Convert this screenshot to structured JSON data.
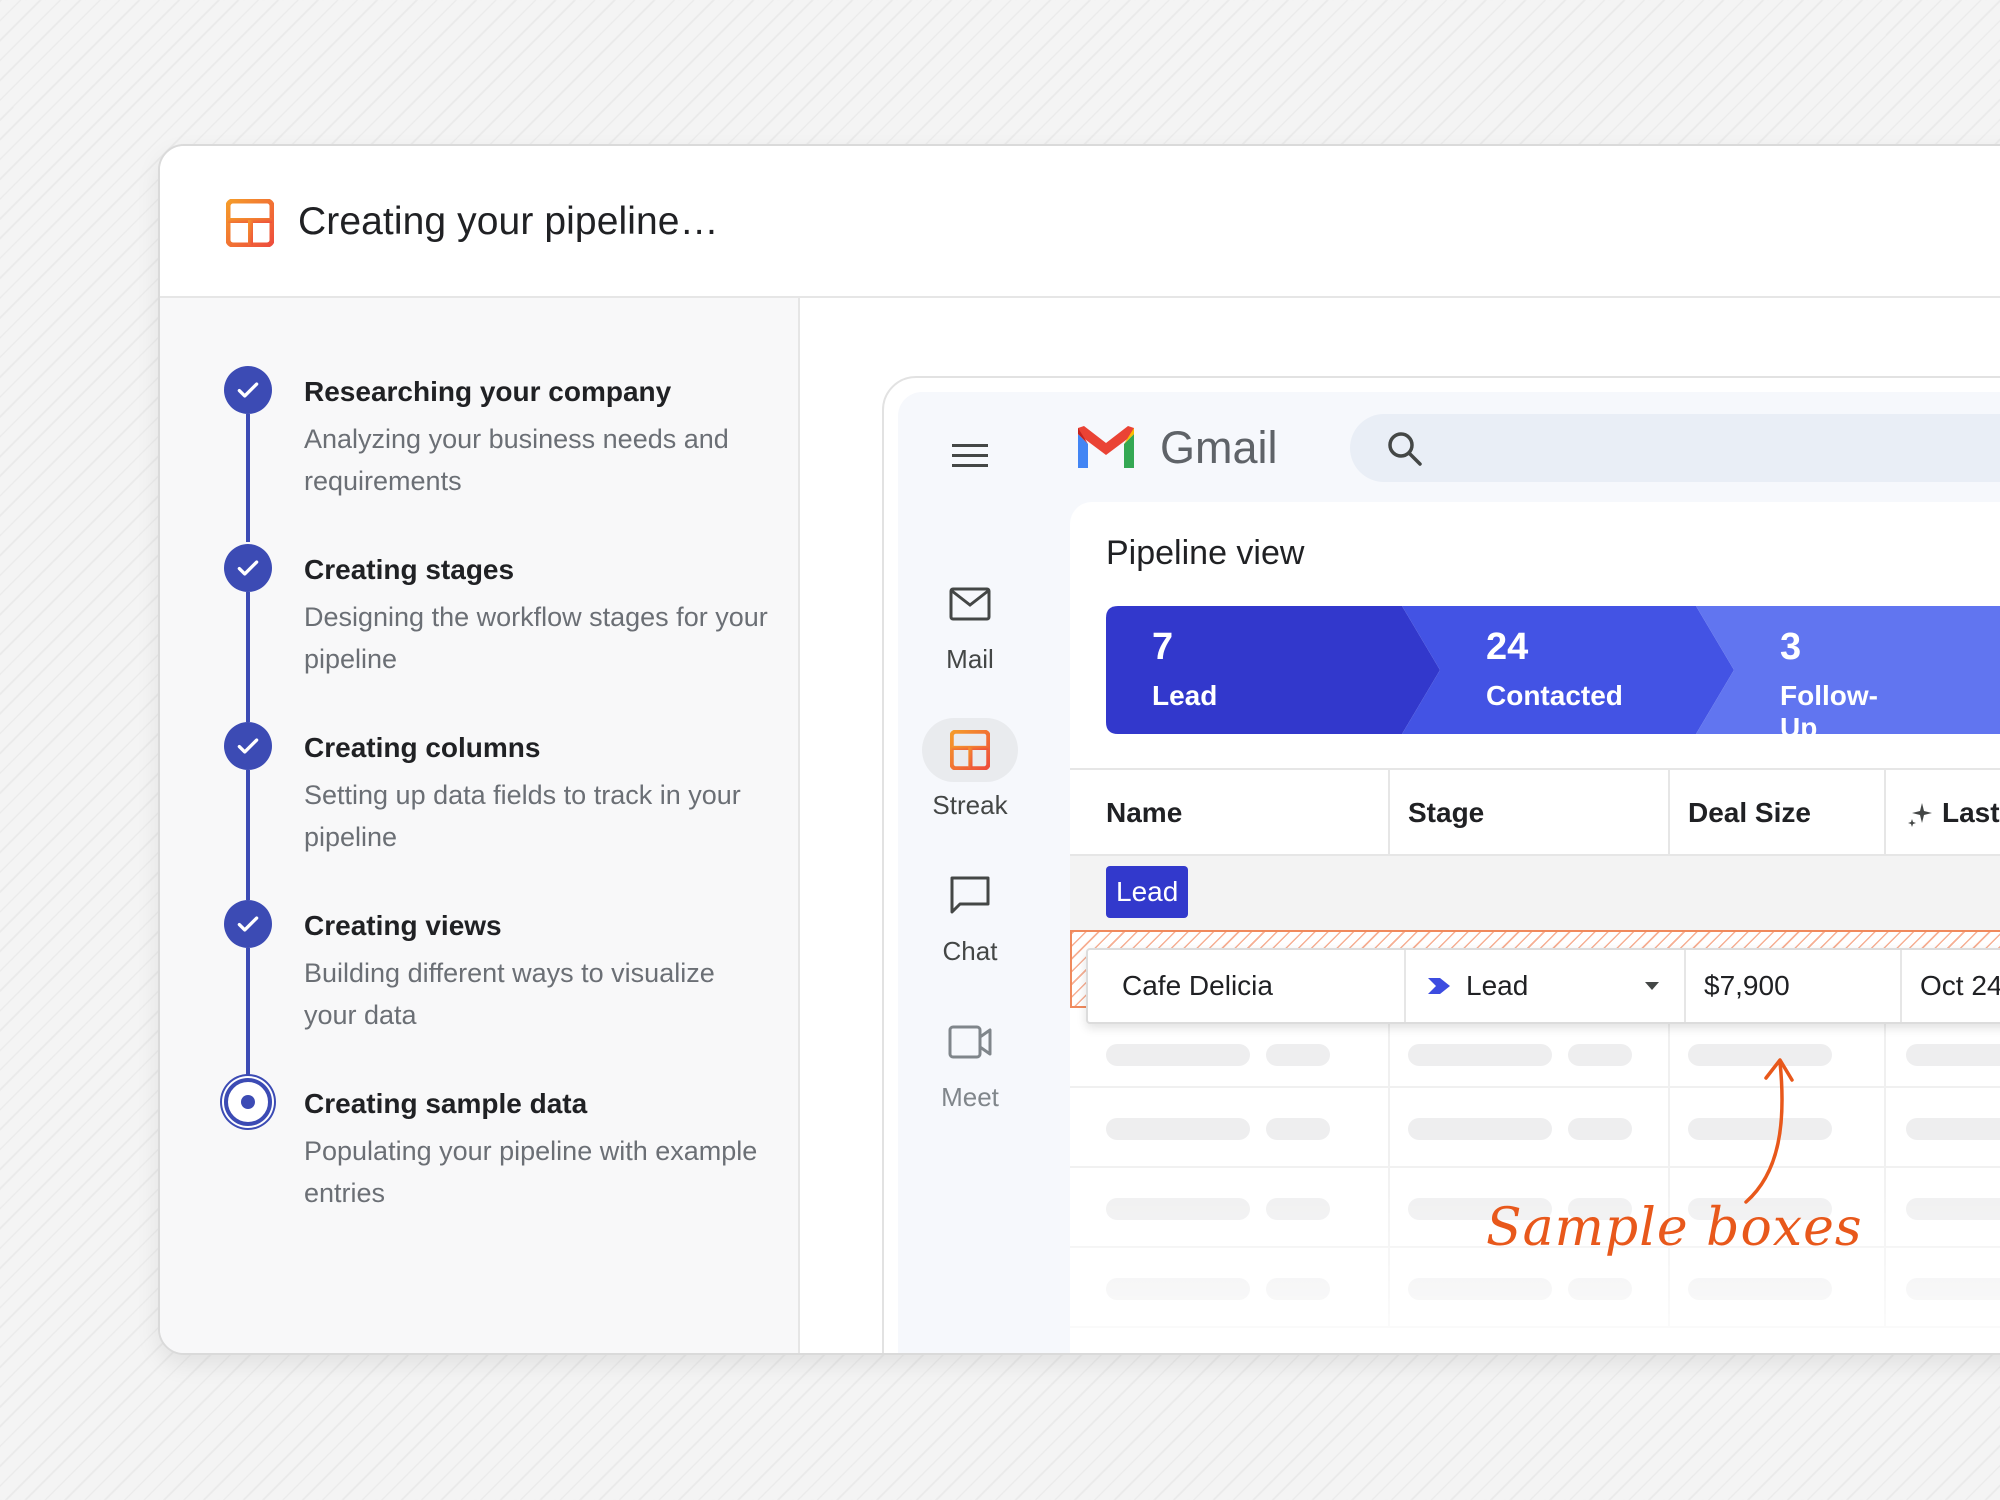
{
  "dialog": {
    "title": "Creating your pipeline…",
    "logo_icon": "streak-box-icon",
    "steps": [
      {
        "title": "Researching your company",
        "description": "Analyzing your business needs and requirements",
        "status": "done"
      },
      {
        "title": "Creating stages",
        "description": "Designing the workflow stages for your pipeline",
        "status": "done"
      },
      {
        "title": "Creating columns",
        "description": "Setting up data fields to track in your pipeline",
        "status": "done"
      },
      {
        "title": "Creating views",
        "description": "Building different ways to visualize your data",
        "status": "done"
      },
      {
        "title": "Creating sample data",
        "description": "Populating your pipeline with example entries",
        "status": "in-progress"
      }
    ]
  },
  "gmail": {
    "brand": "Gmail",
    "rail": [
      {
        "label": "Mail",
        "icon": "mail-icon"
      },
      {
        "label": "Streak",
        "icon": "streak-icon",
        "active": true
      },
      {
        "label": "Chat",
        "icon": "chat-icon"
      },
      {
        "label": "Meet",
        "icon": "meet-icon"
      }
    ]
  },
  "pipeline": {
    "title": "Pipeline view",
    "stages": [
      {
        "count": "7",
        "label": "Lead",
        "color": "#3238cc"
      },
      {
        "count": "24",
        "label": "Contacted",
        "color": "#4353e4"
      },
      {
        "count": "3",
        "label": "Follow-Up",
        "color": "#6175f0"
      }
    ],
    "columns": [
      "Name",
      "Stage",
      "Deal Size",
      "Last"
    ],
    "group_label": "Lead",
    "sample_row": {
      "name": "Cafe Delicia",
      "stage": "Lead",
      "deal_size": "$7,900",
      "date": "Oct 24"
    }
  },
  "annotation": {
    "text": "Sample boxes",
    "color": "#e8581b"
  },
  "colors": {
    "accent": "#3c4bb4",
    "brand_orange": "#f26b2b"
  }
}
